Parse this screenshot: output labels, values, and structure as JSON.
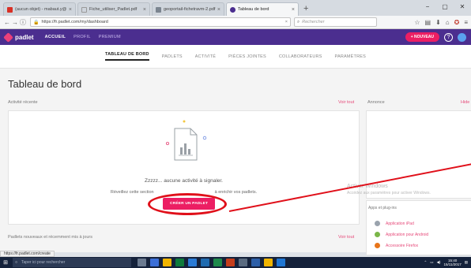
{
  "browser": {
    "tabs": [
      {
        "label": "(aucun objet) - mabaut.y@",
        "color": "#d93025",
        "active": false
      },
      {
        "label": "Fiche_utiliser_Padlet.pdf",
        "color": "#cfd5dc",
        "active": false
      },
      {
        "label": "geoportail-fichetravm-2.pdf",
        "color": "#7b8590",
        "active": false
      },
      {
        "label": "Tableau de bord",
        "color": "#4b2e8f",
        "active": true
      }
    ],
    "new_tab": "+",
    "window_controls": [
      "−",
      "▢",
      "✕"
    ],
    "url": "https://fr.padlet.com/my/dashboard",
    "url_clear": "×",
    "search_placeholder": "Rechercher",
    "status_url": "https://fr.padlet.com/create"
  },
  "padlet": {
    "logo_text": "padlet",
    "nav": [
      {
        "label": "ACCUEIL",
        "active": true
      },
      {
        "label": "PROFIL",
        "active": false
      },
      {
        "label": "PREMIUM",
        "active": false
      }
    ],
    "new_button": "+ NOUVEAU",
    "help_icon": "?"
  },
  "dashboard": {
    "tabs": [
      {
        "label": "TABLEAU DE BORD",
        "active": true
      },
      {
        "label": "PADLETS",
        "active": false
      },
      {
        "label": "ACTIVITÉ",
        "active": false
      },
      {
        "label": "PIÈCES JOINTES",
        "active": false
      },
      {
        "label": "COLLABORATEURS",
        "active": false
      },
      {
        "label": "PARAMÈTRES",
        "active": false
      }
    ],
    "title": "Tableau de bord",
    "activity_heading": "Activité récente",
    "activity_link": "Voir tout",
    "announcement_heading": "Annonce",
    "announcement_link": "Hide",
    "empty_title": "Zzzzz... aucune activité à signaler.",
    "empty_sub_start": "Réveillez cette section",
    "empty_sub_end": "à enrichir vos padlets.",
    "create_button": "CRÉER UN PADLET",
    "padlets_heading": "Padlets nouveaux et récemment mis à jours",
    "padlets_link": "Voir tout",
    "apps_heading": "Apps et plug-ins",
    "apps": [
      {
        "label": "Application iPad",
        "color": "#9aa3ad"
      },
      {
        "label": "Application pour Android",
        "color": "#7ab648"
      },
      {
        "label": "Accessoire Firefox",
        "color": "#e8751a"
      }
    ]
  },
  "watermark": {
    "line1": "Activer Windows",
    "line2": "Accédez aux paramètres pour activer Windows."
  },
  "taskbar": {
    "search_placeholder": "Taper ici pour rechercher",
    "apps": [
      "#6b7a90",
      "#3b6fd8",
      "#f0b400",
      "#0f7b3c",
      "#2a7bd6",
      "#1f6bb0",
      "#1e8a4c",
      "#c43e1c",
      "#5a6b80",
      "#2d5fa8",
      "#f0b400",
      "#1f76d3"
    ],
    "time": "15:40",
    "date": "15/11/2017"
  }
}
